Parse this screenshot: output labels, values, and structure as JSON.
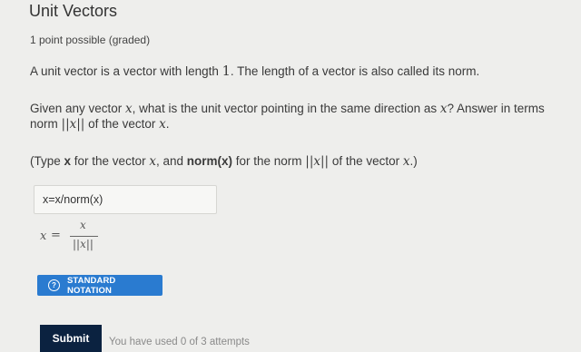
{
  "problem": {
    "title": "Unit Vectors",
    "points": "1 point possible (graded)"
  },
  "para1": {
    "text1": "A unit vector is a vector with length ",
    "num": "1",
    "text2": ". The length of a vector is also called its norm."
  },
  "para2": {
    "text1": "Given any vector ",
    "var1": "x",
    "text2": ", what is the unit vector pointing in the same direction as ",
    "var2": "x",
    "text3": "? Answer in terms",
    "text4": "norm ",
    "norm": "||x||",
    "text5": " of the vector ",
    "var3": "x",
    "text6": "."
  },
  "para3": {
    "text1": "(Type ",
    "bold1": "x",
    "text2": " for the vector ",
    "var1": "x",
    "text3": ", and ",
    "bold2": "norm(x)",
    "text4": " for the norm ",
    "norm": "||x||",
    "text5": " of the vector ",
    "var2": "x",
    "text6": ".)"
  },
  "answer": {
    "value": "x=x/norm(x)"
  },
  "formula": {
    "lhs": "x",
    "eq": "=",
    "numerator": "x",
    "denominator": "||x||"
  },
  "notation_button": {
    "icon": "?",
    "label": "STANDARD NOTATION"
  },
  "submit": {
    "label": "Submit",
    "attempts": "You have used 0 of 3 attempts"
  }
}
